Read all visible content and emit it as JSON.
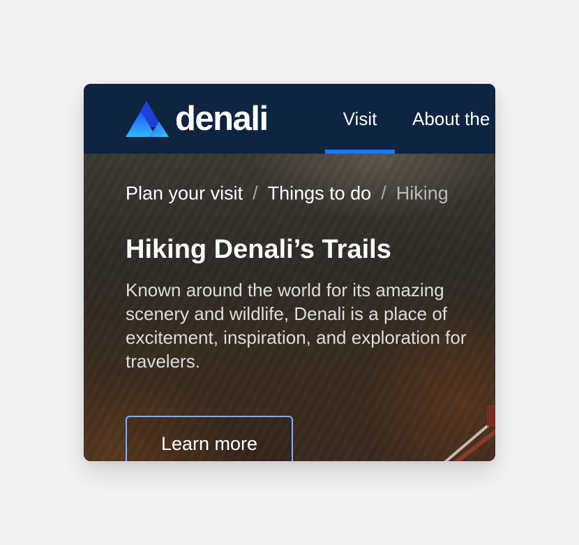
{
  "brand": {
    "name": "denali",
    "logo_icon": "mountain-logo-icon"
  },
  "nav": {
    "items": [
      {
        "label": "Visit",
        "active": true
      },
      {
        "label": "About the"
      }
    ],
    "active_color": "#1978ff"
  },
  "breadcrumb": {
    "items": [
      "Plan your visit",
      "Things to do",
      "Hiking"
    ],
    "separator": "/"
  },
  "hero": {
    "title": "Hiking Denali’s Trails",
    "description": "Known around the world for its amazing scenery and wildlife, Denali is a place of excitement, inspiration, and exploration for travelers.",
    "cta_label": "Learn more"
  },
  "colors": {
    "header_bg": "#0e2440",
    "button_border": "#7fb0ff"
  }
}
